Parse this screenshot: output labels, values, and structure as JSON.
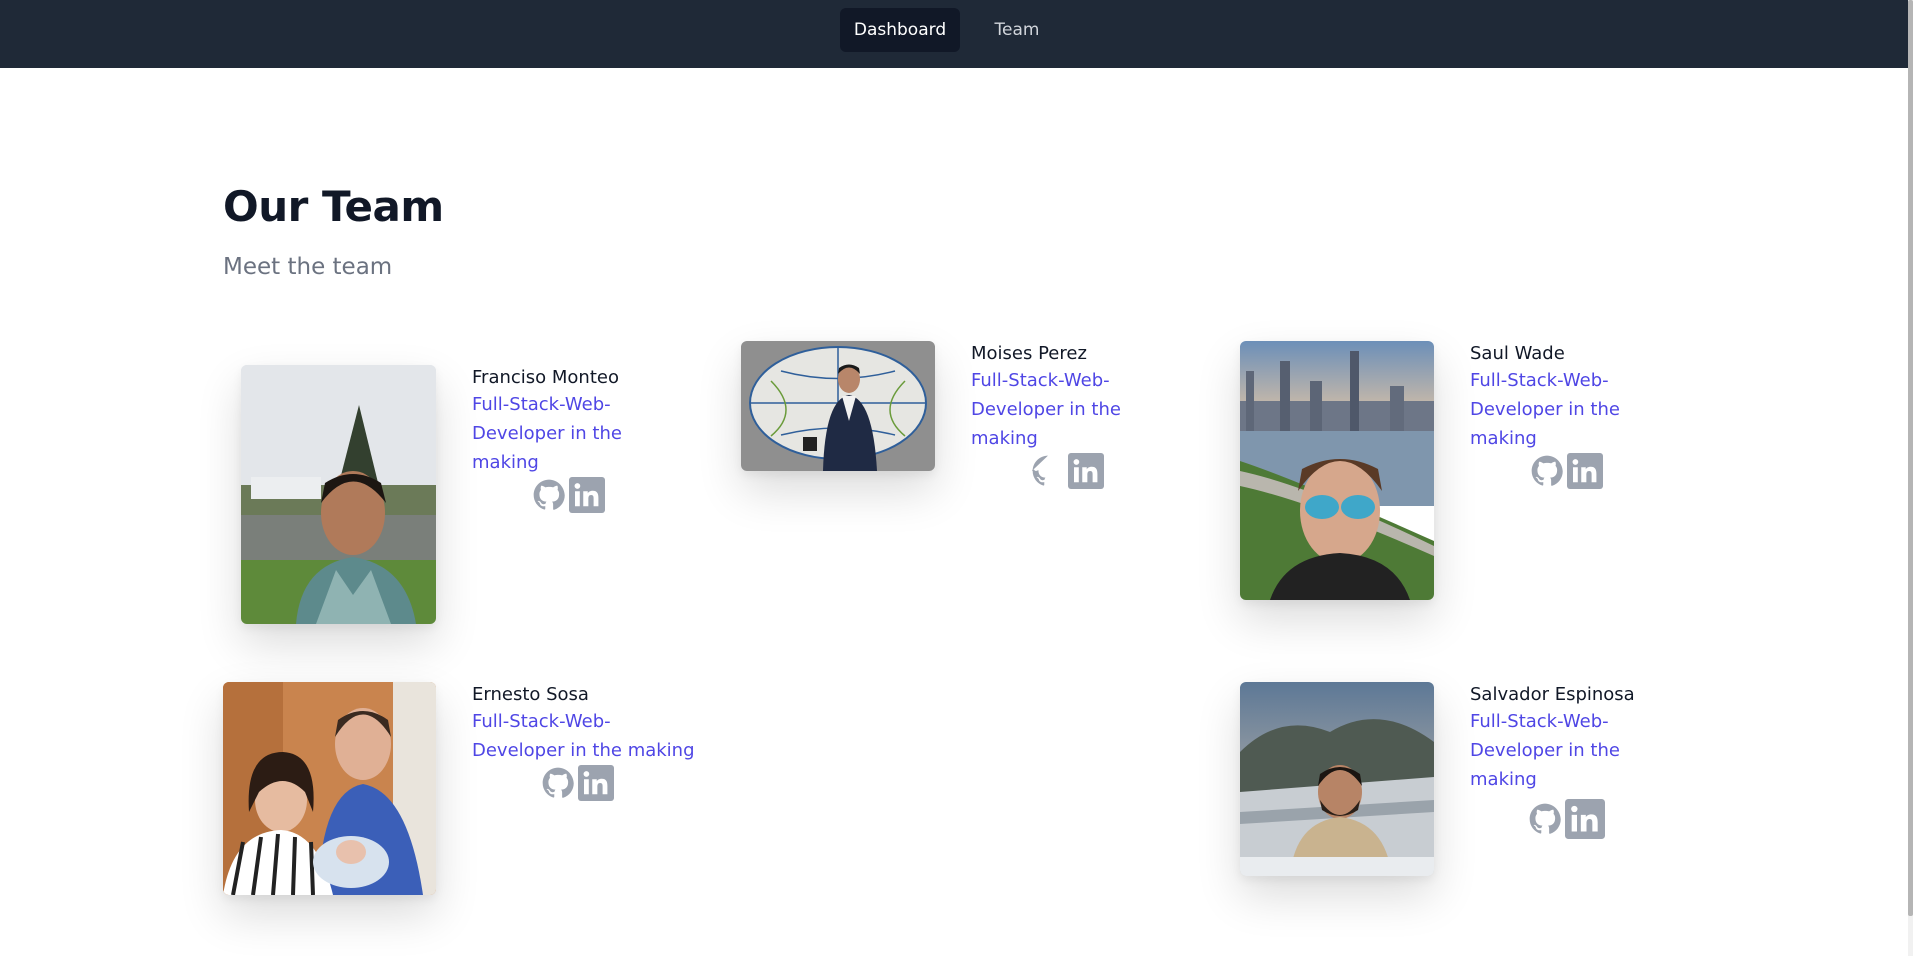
{
  "nav": {
    "items": [
      {
        "label": "Dashboard",
        "active": true
      },
      {
        "label": "Team",
        "active": false
      }
    ]
  },
  "header": {
    "title": "Our Team",
    "subtitle": "Meet the team"
  },
  "members": [
    {
      "name": "Franciso Monteo",
      "role": "Full-Stack-Web-Developer in the making",
      "socials": [
        "github-icon",
        "linkedin-icon"
      ]
    },
    {
      "name": "Moises Perez",
      "role": "Full-Stack-Web-Developer in the making",
      "socials": [
        "github-icon",
        "linkedin-icon"
      ]
    },
    {
      "name": "Saul Wade",
      "role": "Full-Stack-Web-Developer in the making",
      "socials": [
        "github-icon",
        "linkedin-icon"
      ]
    },
    {
      "name": "Ernesto Sosa",
      "role": "Full-Stack-Web-Developer in the making",
      "socials": [
        "github-icon",
        "linkedin-icon"
      ]
    },
    {
      "name": "Salvador Espinosa",
      "role": "Full-Stack-Web-Developer in the making",
      "socials": [
        "github-icon",
        "linkedin-icon"
      ]
    }
  ],
  "colors": {
    "navbar": "#1f2937",
    "nav_active": "#111827",
    "role_text": "#4f46e5",
    "icon_gray": "#9ca3af"
  }
}
